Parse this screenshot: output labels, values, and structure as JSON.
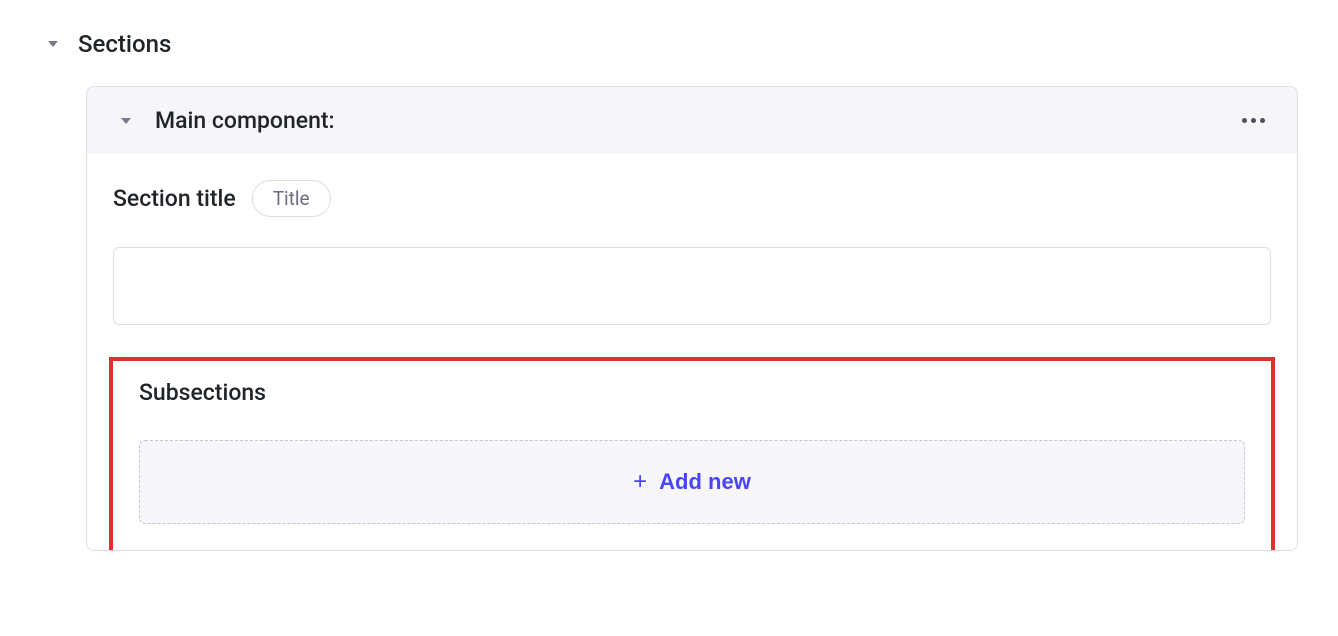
{
  "sections": {
    "label": "Sections"
  },
  "card": {
    "header_title": "Main component:",
    "section_title_label": "Section title",
    "title_pill": "Title",
    "input_value": ""
  },
  "subsections": {
    "label": "Subsections",
    "add_new_label": "Add new"
  }
}
